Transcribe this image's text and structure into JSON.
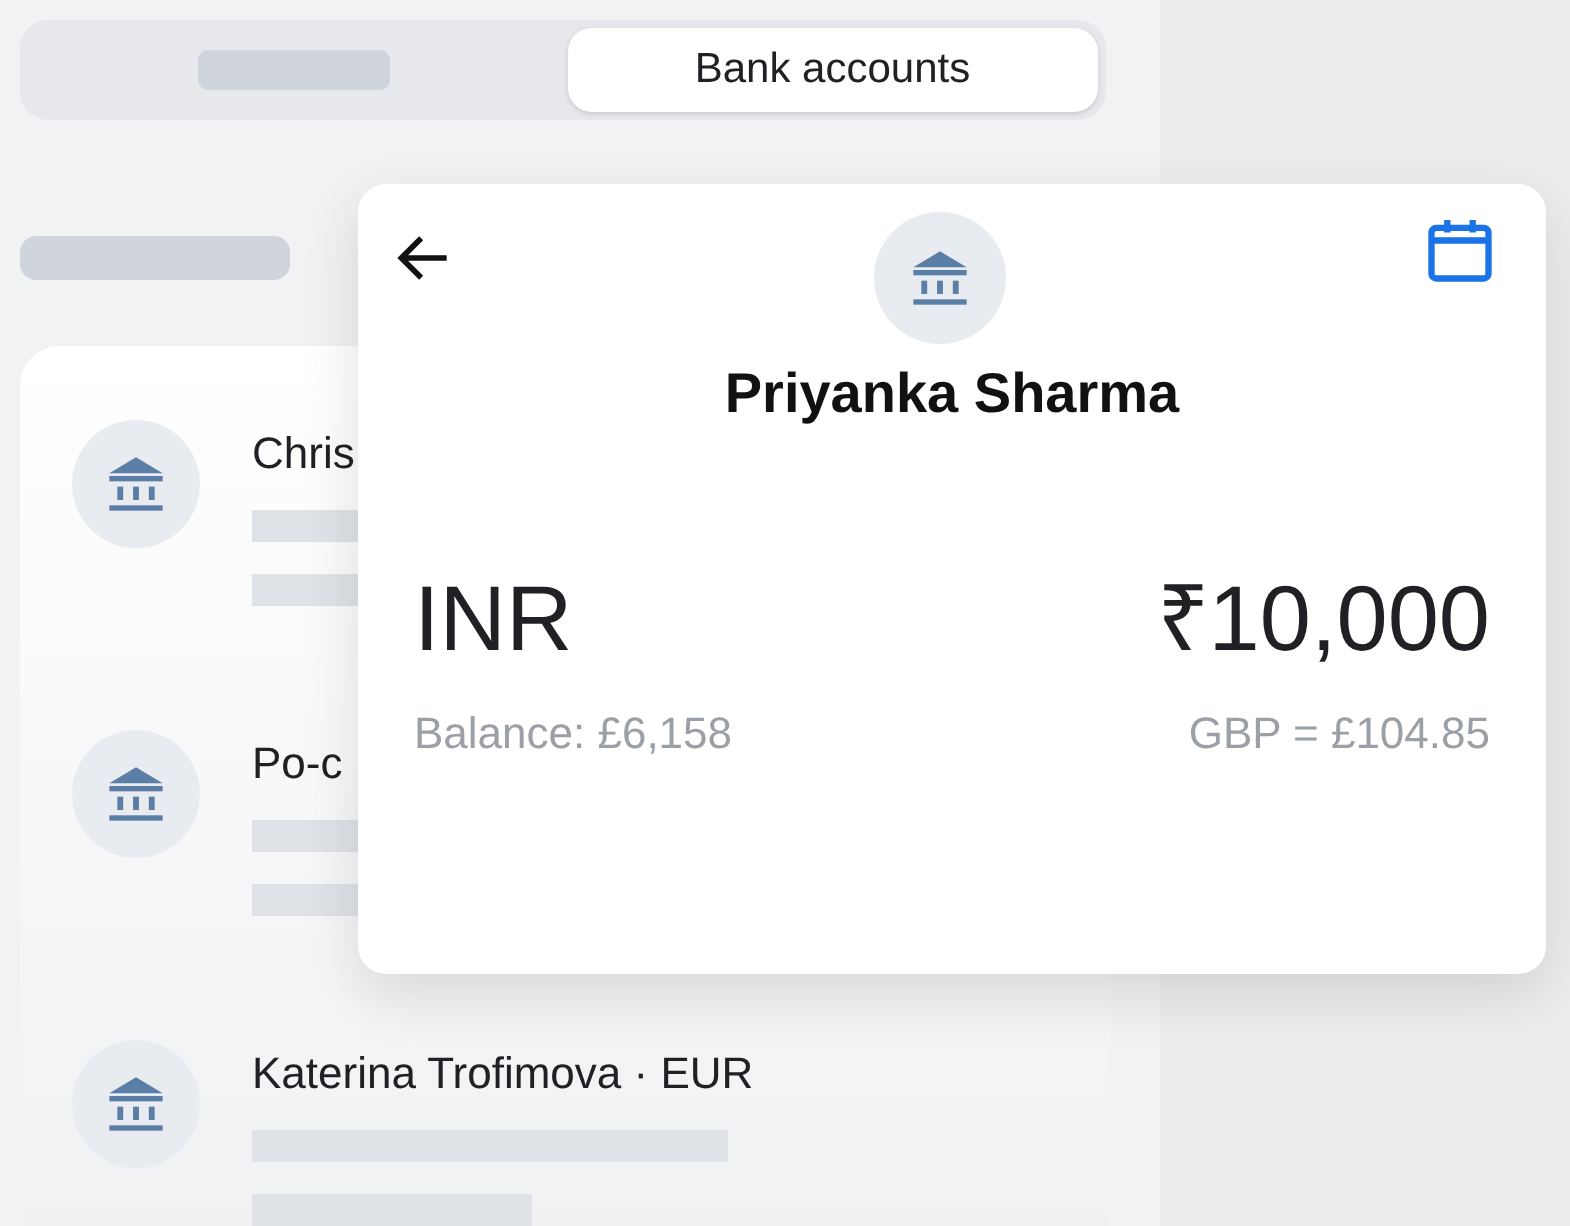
{
  "tabs": [
    {
      "kind": "placeholder",
      "selected": false
    },
    {
      "kind": "label",
      "label": "Bank accounts",
      "selected": true
    }
  ],
  "accounts": [
    {
      "name": "Chris"
    },
    {
      "name": "Po-c"
    },
    {
      "name": "Katerina Trofimova · EUR"
    }
  ],
  "detail": {
    "name": "Priyanka Sharma",
    "currency": "INR",
    "amount": "₹10,000",
    "balance": "Balance: £6,158",
    "conversion": "GBP = £104.85"
  }
}
